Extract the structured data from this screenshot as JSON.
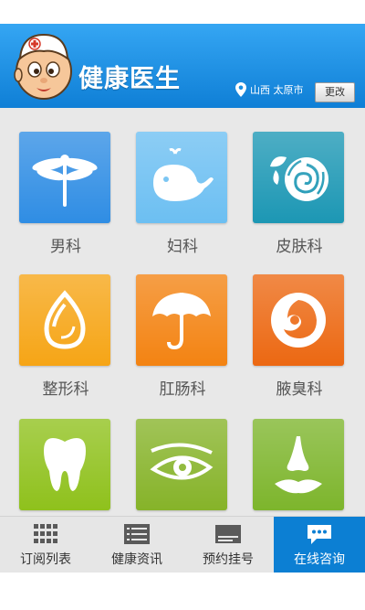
{
  "header": {
    "app_title": "健康医生",
    "location": "山西 太原市",
    "change_button": "更改",
    "brand_color": "#1a8fe3"
  },
  "departments": [
    {
      "label": "男科",
      "icon": "dragonfly-icon",
      "color": "#2f8de4"
    },
    {
      "label": "妇科",
      "icon": "whale-icon",
      "color": "#6cbff2"
    },
    {
      "label": "皮肤科",
      "icon": "rose-icon",
      "color": "#1c97b4"
    },
    {
      "label": "整形科",
      "icon": "droplet-icon",
      "color": "#f6a516"
    },
    {
      "label": "肛肠科",
      "icon": "umbrella-icon",
      "color": "#f38312"
    },
    {
      "label": "腋臭科",
      "icon": "fox-icon",
      "color": "#ec6812"
    },
    {
      "label": "",
      "icon": "tooth-icon",
      "color": "#8fc11c"
    },
    {
      "label": "",
      "icon": "eye-icon",
      "color": "#86b329"
    },
    {
      "label": "",
      "icon": "nose-lips-icon",
      "color": "#7db52c"
    }
  ],
  "tabs": [
    {
      "label": "订阅列表",
      "icon": "grid-icon",
      "active": false
    },
    {
      "label": "健康资讯",
      "icon": "list-icon",
      "active": false
    },
    {
      "label": "预约挂号",
      "icon": "card-icon",
      "active": false
    },
    {
      "label": "在线咨询",
      "icon": "chat-icon",
      "active": true
    }
  ]
}
